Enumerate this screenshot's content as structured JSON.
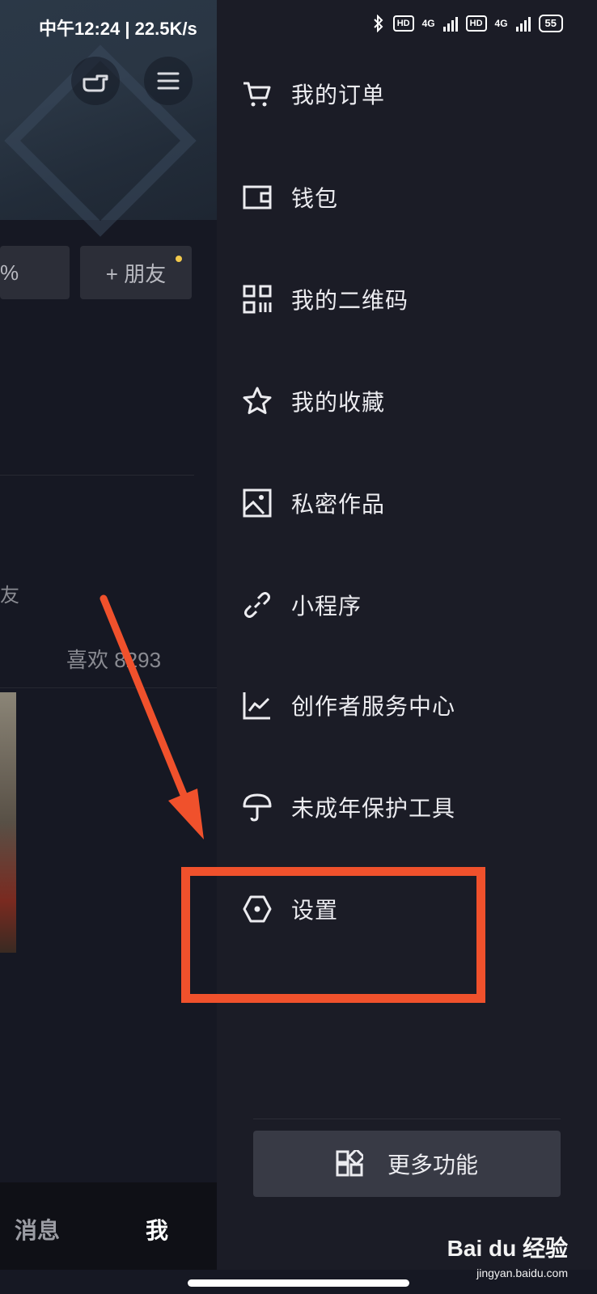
{
  "status_bar": {
    "time": "中午12:24 | 22.5K/s",
    "hd1": "HD",
    "hd2": "HD",
    "net1": "4G",
    "net2": "4G",
    "battery": "55"
  },
  "background": {
    "friend_button": "+ 朋友",
    "percent_fragment": "%",
    "friend_fragment": "友",
    "likes": "喜欢 8293",
    "nav_messages": "消息",
    "nav_me": "我"
  },
  "drawer": {
    "items": [
      {
        "label": "我的订单",
        "icon": "cart-icon"
      },
      {
        "label": "钱包",
        "icon": "wallet-icon"
      },
      {
        "label": "我的二维码",
        "icon": "qr-code-icon"
      },
      {
        "label": "我的收藏",
        "icon": "star-icon"
      },
      {
        "label": "私密作品",
        "icon": "image-icon"
      },
      {
        "label": "小程序",
        "icon": "link-icon"
      },
      {
        "label": "创作者服务中心",
        "icon": "chart-icon"
      },
      {
        "label": "未成年保护工具",
        "icon": "umbrella-icon"
      },
      {
        "label": "设置",
        "icon": "settings-icon"
      }
    ],
    "more_label": "更多功能"
  },
  "watermark": {
    "brand": "Bai du 经验",
    "url": "jingyan.baidu.com"
  },
  "colors": {
    "drawer_bg": "#1b1c26",
    "annotation": "#f0512c"
  }
}
